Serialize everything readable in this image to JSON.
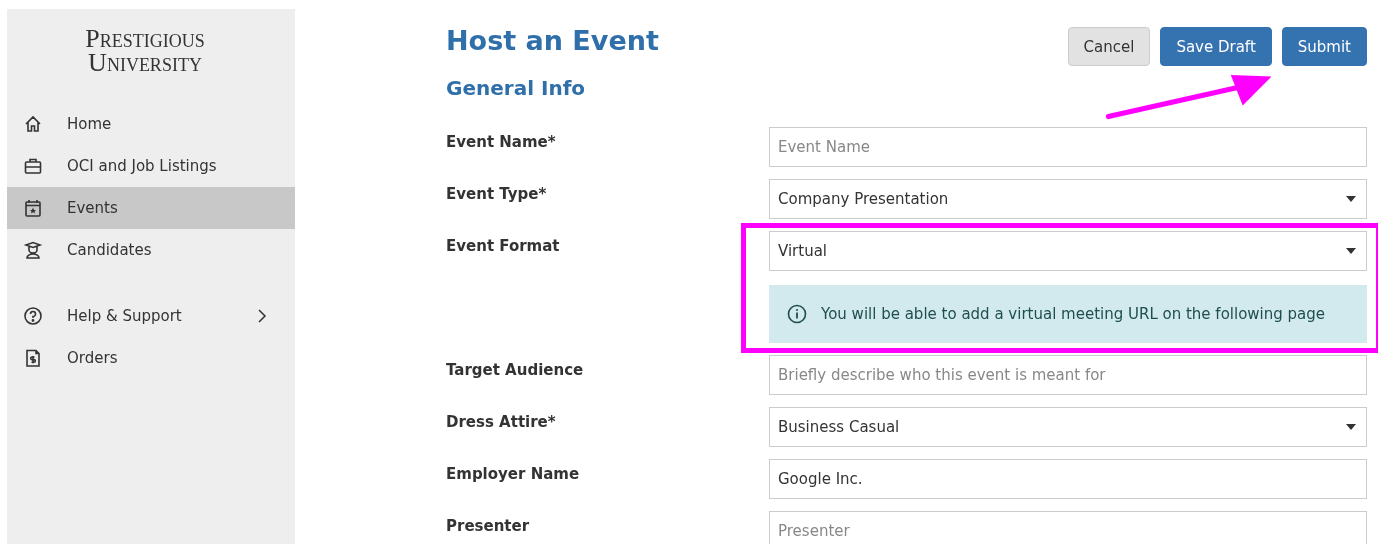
{
  "sidebar": {
    "logo": [
      "Prestigious",
      "University"
    ],
    "items": [
      {
        "label": "Home",
        "kind": "home",
        "selected": false,
        "submenu": false
      },
      {
        "label": "OCI and Job Listings",
        "kind": "briefcase",
        "selected": false,
        "submenu": false
      },
      {
        "label": "Events",
        "kind": "calendar",
        "selected": true,
        "submenu": false
      },
      {
        "label": "Candidates",
        "kind": "graduate",
        "selected": false,
        "submenu": false
      },
      {
        "label": "Help & Support",
        "kind": "help",
        "selected": false,
        "submenu": true
      },
      {
        "label": "Orders",
        "kind": "receipt",
        "selected": false,
        "submenu": false
      }
    ]
  },
  "page": {
    "title": "Host an Event",
    "section": "General Info",
    "buttons": [
      {
        "label": "Cancel",
        "kind": "secondary"
      },
      {
        "label": "Save Draft",
        "kind": "primary"
      },
      {
        "label": "Submit",
        "kind": "primary"
      }
    ],
    "fields": [
      {
        "label": "Event Name*",
        "kind": "text",
        "placeholder": "Event Name"
      },
      {
        "label": "Event Type*",
        "kind": "select",
        "value": "Company Presentation"
      },
      {
        "label": "Event Format",
        "kind": "select",
        "value": "Virtual",
        "note": "You will be able to add a virtual meeting URL on the following page",
        "highlighted": true
      },
      {
        "label": "Target Audience",
        "kind": "text",
        "placeholder": "Briefly describe who this event is meant for"
      },
      {
        "label": "Dress Attire*",
        "kind": "select",
        "value": "Business Casual"
      },
      {
        "label": "Employer Name",
        "kind": "text",
        "value": "Google Inc."
      },
      {
        "label": "Presenter",
        "kind": "text",
        "placeholder": "Presenter"
      }
    ]
  },
  "annotation_arrow": true
}
